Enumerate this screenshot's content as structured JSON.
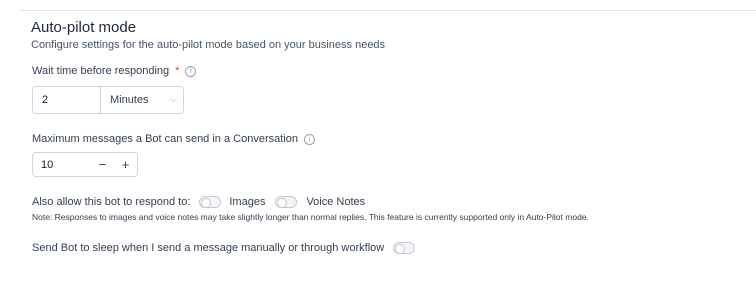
{
  "section": {
    "title": "Auto-pilot mode",
    "subtitle": "Configure settings for the auto-pilot mode based on your business needs"
  },
  "wait_time": {
    "label": "Wait time before responding",
    "required_mark": "*",
    "value": "2",
    "unit_selected": "Minutes"
  },
  "max_messages": {
    "label": "Maximum messages a Bot can send in a Conversation",
    "value": "10",
    "decrement": "−",
    "increment": "+"
  },
  "respond_to": {
    "label": "Also allow this bot to respond to:",
    "options": [
      {
        "label": "Images",
        "enabled": false
      },
      {
        "label": "Voice Notes",
        "enabled": false
      }
    ],
    "note": "Note: Responses to images and voice notes may take slightly longer than normal replies. This feature is currently supported only in Auto-Pilot mode."
  },
  "sleep": {
    "label": "Send Bot to sleep when I send a message manually or through workflow",
    "enabled": false
  },
  "icons": {
    "info": "info-icon",
    "chevron": "chevron-down-icon"
  }
}
